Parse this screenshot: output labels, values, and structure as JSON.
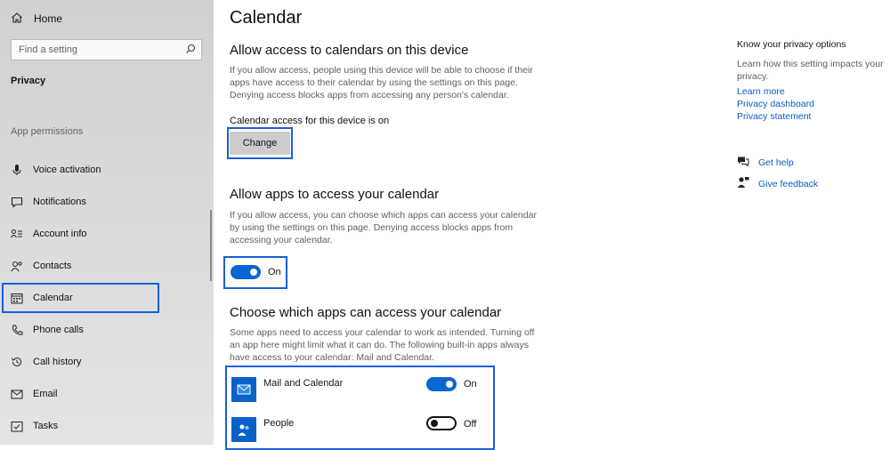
{
  "sidebar": {
    "home_label": "Home",
    "search_placeholder": "Find a setting",
    "section_title": "Privacy",
    "group_label": "App permissions",
    "items": [
      {
        "label": "Voice activation",
        "icon": "microphone-icon"
      },
      {
        "label": "Notifications",
        "icon": "notification-icon"
      },
      {
        "label": "Account info",
        "icon": "account-info-icon"
      },
      {
        "label": "Contacts",
        "icon": "contacts-icon"
      },
      {
        "label": "Calendar",
        "icon": "calendar-icon",
        "selected": true
      },
      {
        "label": "Phone calls",
        "icon": "phone-icon"
      },
      {
        "label": "Call history",
        "icon": "history-icon"
      },
      {
        "label": "Email",
        "icon": "email-icon"
      },
      {
        "label": "Tasks",
        "icon": "tasks-icon"
      }
    ]
  },
  "main": {
    "title": "Calendar",
    "device_section": {
      "heading": "Allow access to calendars on this device",
      "description": "If you allow access, people using this device will be able to choose if their apps have access to their calendar by using the settings on this page. Denying access blocks apps from accessing any person's calendar.",
      "status": "Calendar access for this device is on",
      "button_label": "Change"
    },
    "apps_section": {
      "heading": "Allow apps to access your calendar",
      "description": "If you allow access, you can choose which apps can access your calendar by using the settings on this page. Denying access blocks apps from accessing your calendar.",
      "toggle_state": "On"
    },
    "choose_section": {
      "heading": "Choose which apps can access your calendar",
      "description": "Some apps need to access your calendar to work as intended. Turning off an app here might limit what it can do. The following built-in apps always have access to your calendar: Mail and Calendar.",
      "apps": [
        {
          "name": "Mail and Calendar",
          "state": "On",
          "icon": "mail-calendar-icon"
        },
        {
          "name": "People",
          "state": "Off",
          "icon": "people-icon"
        }
      ]
    }
  },
  "right": {
    "title": "Know your privacy options",
    "description": "Learn how this setting impacts your privacy.",
    "links": [
      "Learn more",
      "Privacy dashboard",
      "Privacy statement"
    ],
    "get_help": "Get help",
    "give_feedback": "Give feedback"
  },
  "colors": {
    "accent": "#0a66d0",
    "highlight": "#1a5fd6",
    "link": "#0b5bc4",
    "sidebar_bg": "#d6d7d9"
  }
}
